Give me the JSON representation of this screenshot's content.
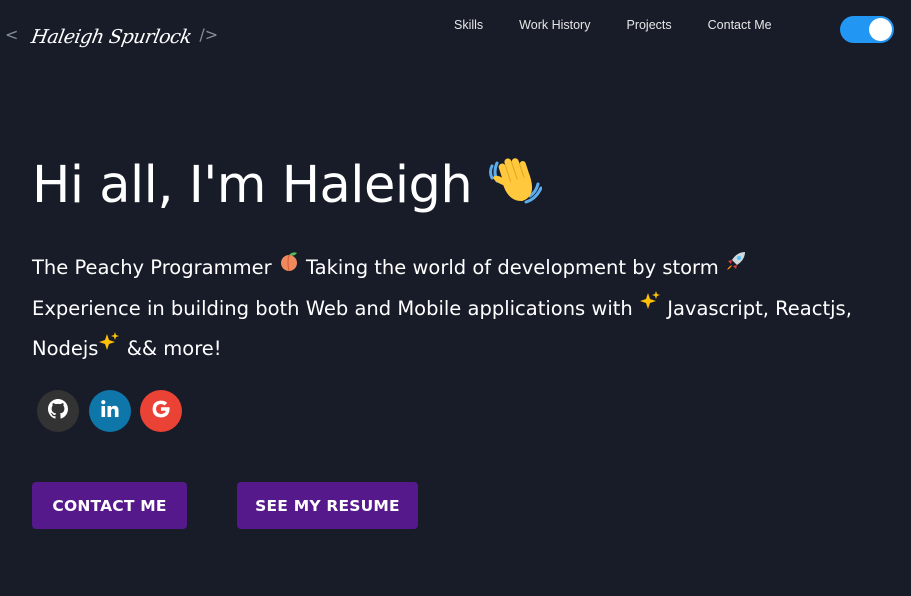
{
  "header": {
    "logo_open": "<",
    "logo_name": "Haleigh Spurlock",
    "logo_close": "/>",
    "nav": [
      "Skills",
      "Work History",
      "Projects",
      "Contact Me"
    ],
    "theme_toggle_on": true
  },
  "hero": {
    "title": "Hi all, I'm Haleigh",
    "line1_a": "The Peachy Programmer",
    "line1_b": "Taking the world of development by storm",
    "line2_a": "Experience in building both Web and Mobile applications with",
    "line2_b": "Javascript, Reactjs, Nodejs",
    "line2_c": "&& more!"
  },
  "socials": [
    "github-icon",
    "linkedin-icon",
    "google-icon"
  ],
  "buttons": {
    "contact": "CONTACT ME",
    "resume": "SEE MY RESUME"
  },
  "colors": {
    "background": "#171c28",
    "button": "#55198b",
    "toggle": "#2196f3",
    "github": "#333333",
    "linkedin": "#0e76a8",
    "google": "#ea4335"
  }
}
